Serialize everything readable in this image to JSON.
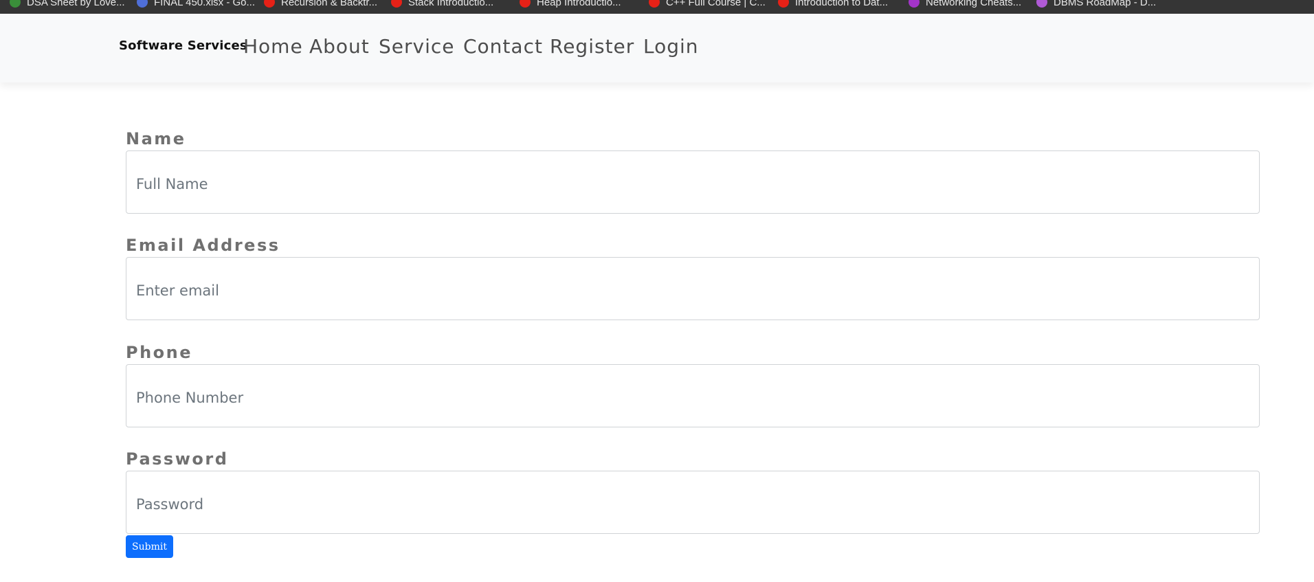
{
  "bookmarks": [
    {
      "label": "DSA Sheet by Love...",
      "icon": "green-leaf-icon",
      "color": "#3a8f3a"
    },
    {
      "label": "FINAL 450.xlsx - Go...",
      "icon": "sheets-icon",
      "color": "#4f6fd8"
    },
    {
      "label": "Recursion & Backtr...",
      "icon": "youtube-icon",
      "color": "#e62117"
    },
    {
      "label": "Stack Introductio...",
      "icon": "youtube-icon",
      "color": "#e62117"
    },
    {
      "label": "Heap Introductio...",
      "icon": "youtube-icon",
      "color": "#e62117"
    },
    {
      "label": "C++ Full Course | C...",
      "icon": "youtube-icon",
      "color": "#e62117"
    },
    {
      "label": "Introduction to Dat...",
      "icon": "youtube-icon",
      "color": "#e62117"
    },
    {
      "label": "Networking Cheats...",
      "icon": "purple-circle-icon",
      "color": "#a334c9"
    },
    {
      "label": "DBMS RoadMap - D...",
      "icon": "roadmap-icon",
      "color": "#b05ad6"
    }
  ],
  "navbar": {
    "brand": "Software Services",
    "links": [
      "Home",
      "About",
      "Service",
      "Contact",
      "Register",
      "Login"
    ]
  },
  "form": {
    "fields": [
      {
        "label": "Name",
        "placeholder": "Full Name",
        "type": "text"
      },
      {
        "label": "Email Address",
        "placeholder": "Enter email",
        "type": "email"
      },
      {
        "label": "Phone",
        "placeholder": "Phone Number",
        "type": "text"
      },
      {
        "label": "Password",
        "placeholder": "Password",
        "type": "password"
      }
    ],
    "submit_label": "Submit"
  },
  "colors": {
    "bookmark_bar": "#353535",
    "navbar_bg": "#f8f9fa",
    "primary": "#0d6efd",
    "label_text": "#707070",
    "nav_text": "#4d4d4d"
  }
}
